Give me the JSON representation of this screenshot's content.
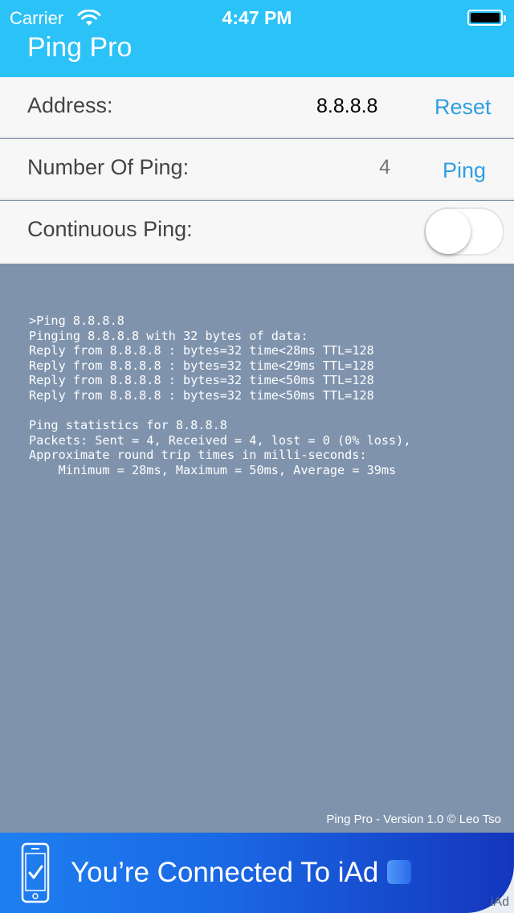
{
  "status_bar": {
    "carrier": "Carrier",
    "time": "4:47 PM",
    "icons": [
      "wifi-icon",
      "battery-icon"
    ]
  },
  "header": {
    "title": "Ping Pro"
  },
  "rows": {
    "address": {
      "label": "Address:",
      "value": "8.8.8.8",
      "action": "Reset"
    },
    "count": {
      "label": "Number Of Ping:",
      "placeholder": "4",
      "action": "Ping"
    },
    "continuous": {
      "label": "Continuous Ping:",
      "toggle_on": false
    }
  },
  "console": {
    "lines": [
      ">Ping 8.8.8.8",
      "Pinging 8.8.8.8 with 32 bytes of data:",
      "Reply from 8.8.8.8 : bytes=32 time<28ms TTL=128",
      "Reply from 8.8.8.8 : bytes=32 time<29ms TTL=128",
      "Reply from 8.8.8.8 : bytes=32 time<50ms TTL=128",
      "Reply from 8.8.8.8 : bytes=32 time<50ms TTL=128",
      "",
      "Ping statistics for 8.8.8.8",
      "Packets: Sent = 4, Received = 4, lost = 0 (0% loss),",
      "Approximate round trip times in milli-seconds:",
      "    Minimum = 28ms, Maximum = 50ms, Average = 39ms"
    ],
    "footer": "Ping Pro - Version 1.0 © Leo Tso"
  },
  "ad": {
    "text": "You’re Connected To iAd",
    "label": "iAd"
  },
  "colors": {
    "header": "#2bc2f7",
    "accent": "#2e9fe0",
    "console_bg": "#7f93ad"
  }
}
